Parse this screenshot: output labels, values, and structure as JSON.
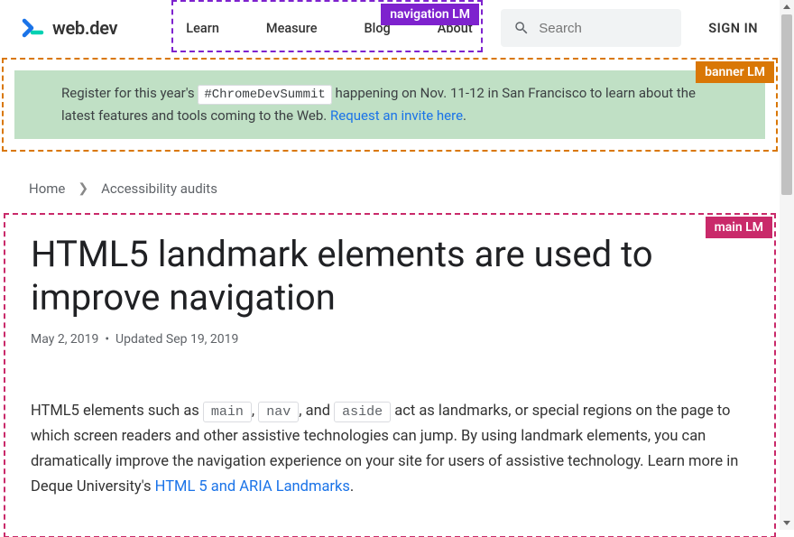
{
  "logo_text": "web.dev",
  "nav": {
    "items": [
      "Learn",
      "Measure",
      "Blog",
      "About"
    ]
  },
  "overlays": {
    "navigation": "navigation LM",
    "banner": "banner LM",
    "main": "main LM"
  },
  "search": {
    "placeholder": "Search"
  },
  "signin": "SIGN IN",
  "banner": {
    "prefix": "Register for this year's",
    "hashtag": "#ChromeDevSummit",
    "mid": "happening on Nov. 11-12 in San Francisco to learn about the latest features and tools coming to the Web.",
    "link": "Request an invite here",
    "suffix": "."
  },
  "breadcrumb": {
    "items": [
      "Home",
      "Accessibility audits"
    ]
  },
  "article": {
    "title": "HTML5 landmark elements are used to improve navigation",
    "published": "May 2, 2019",
    "updated_label": "Updated",
    "updated": "Sep 19, 2019",
    "body": {
      "p1a": "HTML5 elements such as",
      "code1": "main",
      "p1b": ",",
      "code2": "nav",
      "p1c": ", and",
      "code3": "aside",
      "p1d": "act as landmarks, or special regions on the page to which screen readers and other assistive technologies can jump. By using landmark elements, you can dramatically improve the navigation experience on your site for users of assistive technology. Learn more in Deque University's",
      "link": "HTML 5 and ARIA Landmarks",
      "p1e": "."
    }
  }
}
